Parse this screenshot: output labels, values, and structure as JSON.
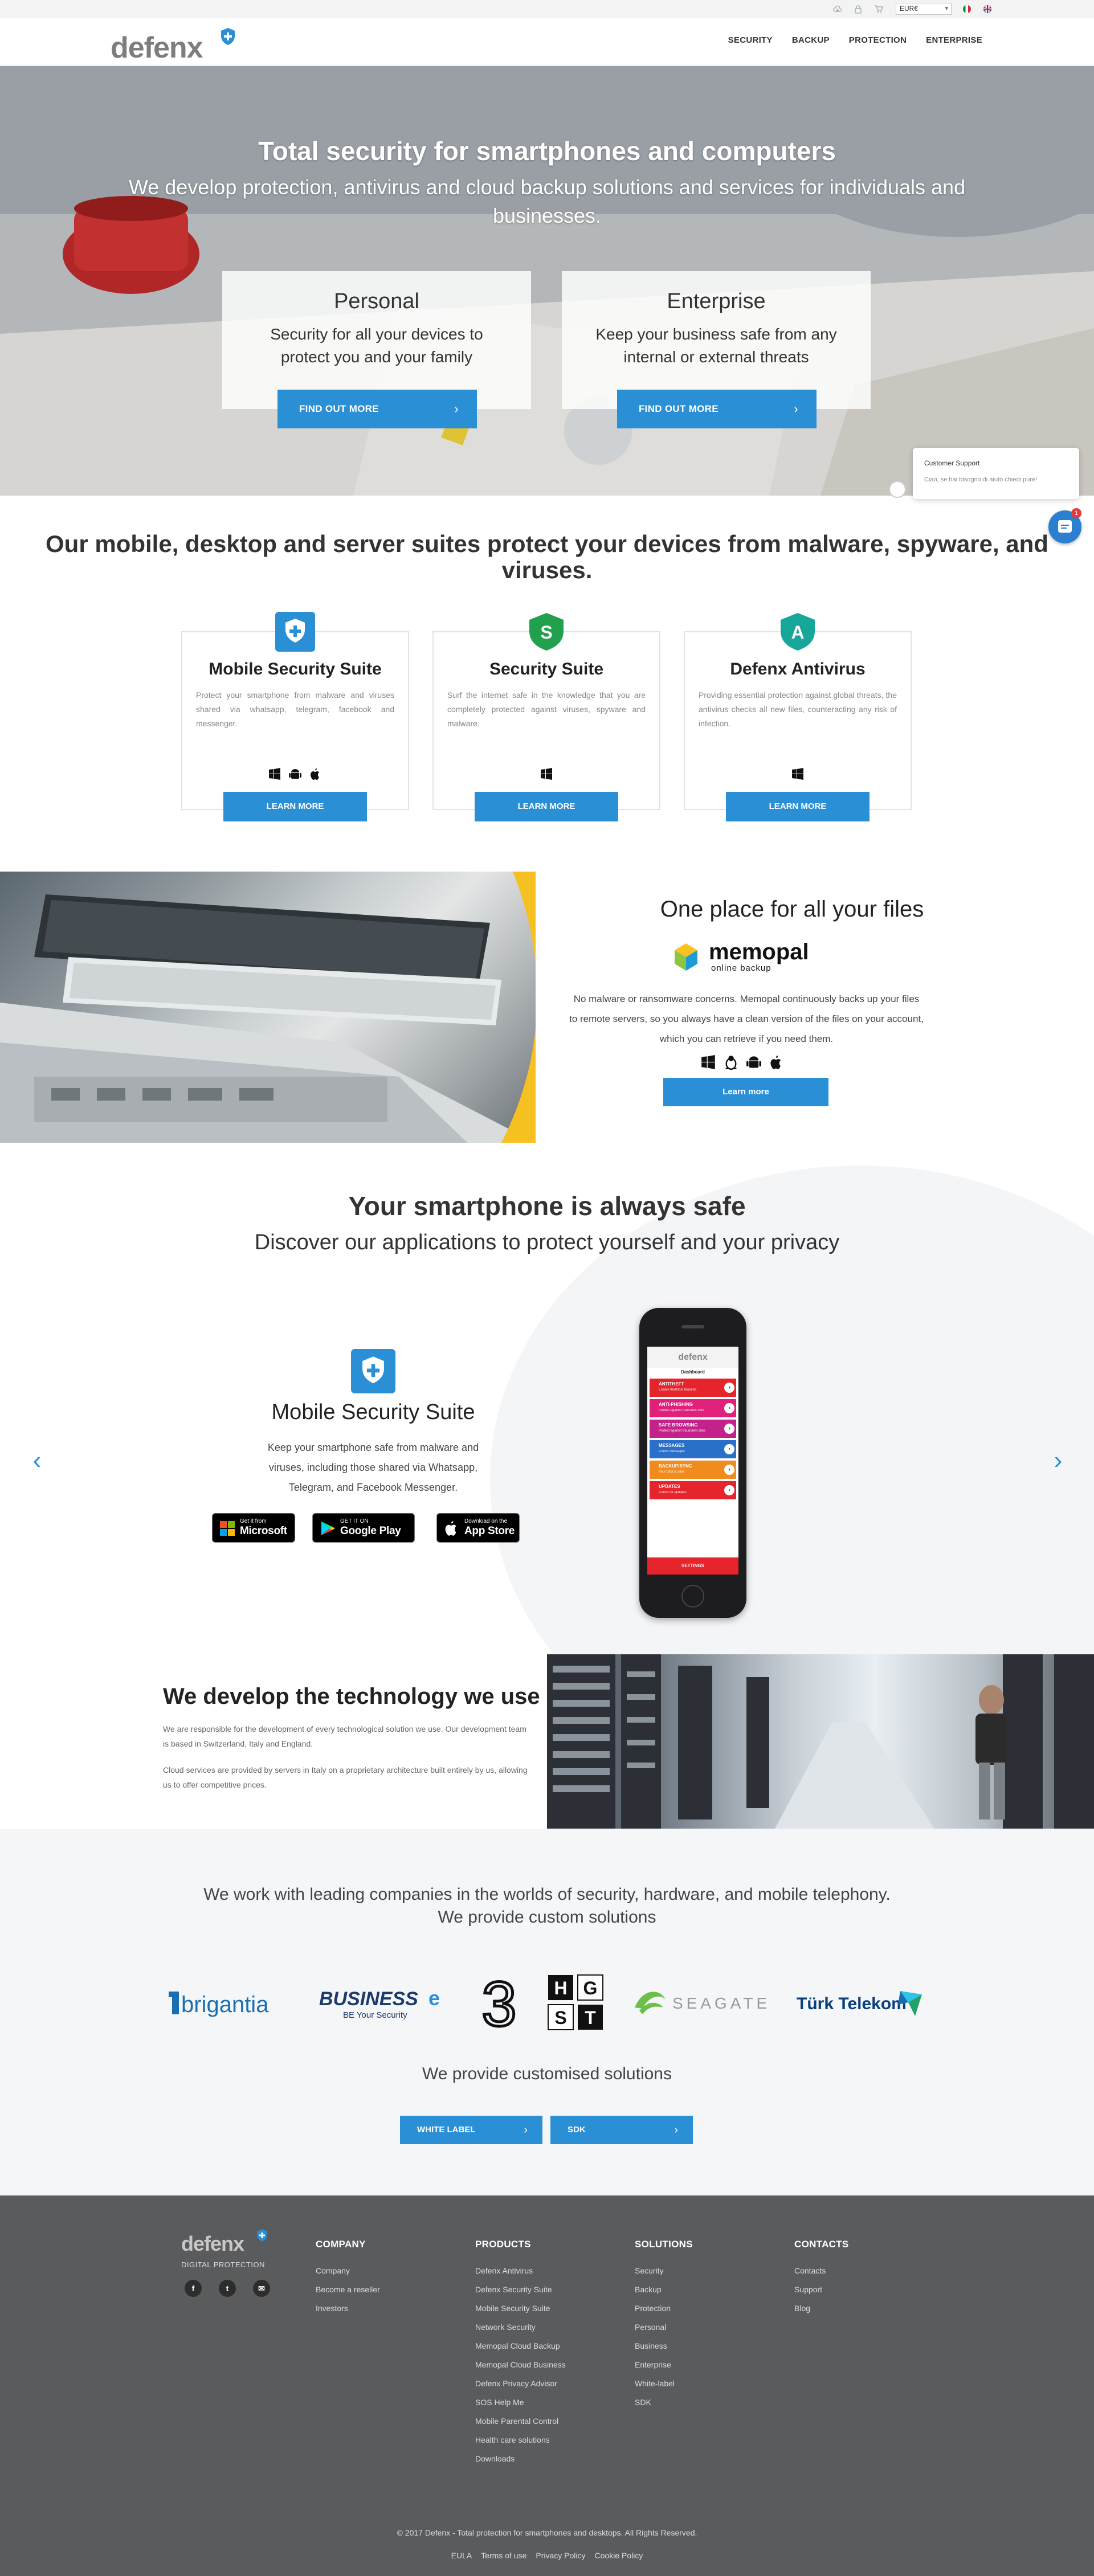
{
  "topbar": {
    "currency": "EUR€",
    "icons": [
      "cloud-download-icon",
      "lock-icon",
      "cart-icon"
    ],
    "languages": [
      "it",
      "en"
    ]
  },
  "header": {
    "logo_text": "defenx",
    "nav": [
      "SECURITY",
      "BACKUP",
      "PROTECTION",
      "ENTERPRISE"
    ]
  },
  "hero": {
    "title": "Total security for smartphones and computers",
    "subtitle": "We develop protection, antivirus and cloud backup solutions and services for individuals and businesses.",
    "cards": [
      {
        "title": "Personal",
        "text": "Security for all your devices to protect you and your family",
        "button": "FIND OUT MORE"
      },
      {
        "title": "Enterprise",
        "text": "Keep your business safe from any internal or external threats",
        "button": "FIND OUT MORE"
      }
    ]
  },
  "chat": {
    "title": "Customer Support",
    "message": "Ciao, se hai bisogno di aiuto chiedi pure!",
    "badge": "1"
  },
  "suites": {
    "title": "Our mobile, desktop and server suites protect your devices from malware, spyware, and viruses.",
    "cards": [
      {
        "title": "Mobile Security Suite",
        "text": "Protect your smartphone from malware and viruses shared via whatsapp, telegram, facebook and messenger.",
        "button": "LEARN MORE",
        "icon_color": "#2a8fd5",
        "icon_letter": "+",
        "os": [
          "windows-icon",
          "android-icon",
          "apple-icon"
        ]
      },
      {
        "title": "Security Suite",
        "text": "Surf the internet safe in the knowledge that you are completely protected against viruses, spyware and malware.",
        "button": "LEARN MORE",
        "icon_color": "#21a04e",
        "icon_letter": "S",
        "os": [
          "windows-icon"
        ]
      },
      {
        "title": "Defenx Antivirus",
        "text": "Providing essential protection against global threats, the antivirus checks all new files, counteracting any risk of infection.",
        "button": "LEARN MORE",
        "icon_color": "#16a79a",
        "icon_letter": "A",
        "os": [
          "windows-icon"
        ]
      }
    ]
  },
  "files": {
    "title": "One place for all your files",
    "logo_text": "memopal",
    "logo_sub": "online backup",
    "text": "No malware or ransomware concerns. Memopal continuously backs up your files to remote servers, so you always have a clean version of the files on your account, which you can retrieve if you need them.",
    "os": [
      "windows-icon",
      "linux-icon",
      "android-icon",
      "apple-icon"
    ],
    "button": "Learn more"
  },
  "smartphone": {
    "title": "Your smartphone is always safe",
    "subtitle": "Discover our applications to protect yourself and your privacy",
    "app_title": "Mobile Security Suite",
    "app_text": "Keep your smartphone safe from malware and viruses, including those shared via Whatsapp, Telegram, and Facebook Messenger.",
    "stores": [
      {
        "line1": "Get it from",
        "line2": "Microsoft"
      },
      {
        "line1": "GET IT ON",
        "line2": "Google Play"
      },
      {
        "line1": "Download on the",
        "line2": "App Store"
      }
    ],
    "phone": {
      "brand": "defenx",
      "screen_title": "Dashboard",
      "rows": [
        {
          "label": "ANTITHEFT",
          "desc": "Enable theft/lost features",
          "color": "#e5242b"
        },
        {
          "label": "ANTI-PHISHING",
          "desc": "Protect against malicious sms",
          "color": "#e0207a"
        },
        {
          "label": "SAFE BROWSING",
          "desc": "Protect against fraudulent sites",
          "color": "#c5218a"
        },
        {
          "label": "MESSAGES",
          "desc": "Check messages",
          "color": "#2a6fc9"
        },
        {
          "label": "BACKUP/SYNC",
          "desc": "Your data is safe",
          "color": "#f08c1e"
        },
        {
          "label": "UPDATES",
          "desc": "Check for updates",
          "color": "#e5242b"
        }
      ],
      "footer": "SETTINGS"
    }
  },
  "tech": {
    "title": "We develop the technology we use",
    "p1": "We are responsible for the development of every technological solution we use. Our development team is based in Switzerland, Italy and England.",
    "p2": "Cloud services are provided by servers in Italy on a proprietary architecture built entirely by us, allowing us to offer competitive prices."
  },
  "partners": {
    "text_line1": "We work with leading companies in the worlds of security, hardware, and mobile telephony.",
    "text_line2": "We provide custom solutions",
    "logos": [
      {
        "name": "brigantia",
        "text": "brigantia"
      },
      {
        "name": "business-e",
        "text": "BUSINESS",
        "text2": "e",
        "sub": "BE Your Security"
      },
      {
        "name": "three",
        "text": "3"
      },
      {
        "name": "hgst",
        "text": "HGST"
      },
      {
        "name": "seagate",
        "text": "SEAGATE"
      },
      {
        "name": "turk-telekom",
        "text": "Türk Telekom"
      }
    ],
    "custom_text": "We provide customised solutions",
    "buttons": [
      "WHITE LABEL",
      "SDK"
    ]
  },
  "footer": {
    "logo_text": "defenx",
    "tagline": "DIGITAL PROTECTION",
    "social": [
      "f",
      "t",
      "✉"
    ],
    "columns": [
      {
        "title": "COMPANY",
        "items": [
          "Company",
          "Become a reseller",
          "Investors"
        ]
      },
      {
        "title": "PRODUCTS",
        "items": [
          "Defenx Antivirus",
          "Defenx Security Suite",
          "Mobile Security Suite",
          "Network Security",
          "Memopal Cloud Backup",
          "Memopal Cloud Business",
          "Defenx Privacy Advisor",
          "SOS Help Me",
          "Mobile Parental Control",
          "Health care solutions",
          "Downloads"
        ]
      },
      {
        "title": "SOLUTIONS",
        "items": [
          "Security",
          "Backup",
          "Protection",
          "Personal",
          "Business",
          "Enterprise",
          "White-label",
          "SDK"
        ]
      },
      {
        "title": "CONTACTS",
        "items": [
          "Contacts",
          "Support",
          "Blog"
        ]
      }
    ],
    "copyright": "© 2017 Defenx - Total protection for smartphones and desktops. All Rights Reserved.",
    "legal": [
      "EULA",
      "Terms of use",
      "Privacy Policy",
      "Cookie Policy"
    ]
  }
}
